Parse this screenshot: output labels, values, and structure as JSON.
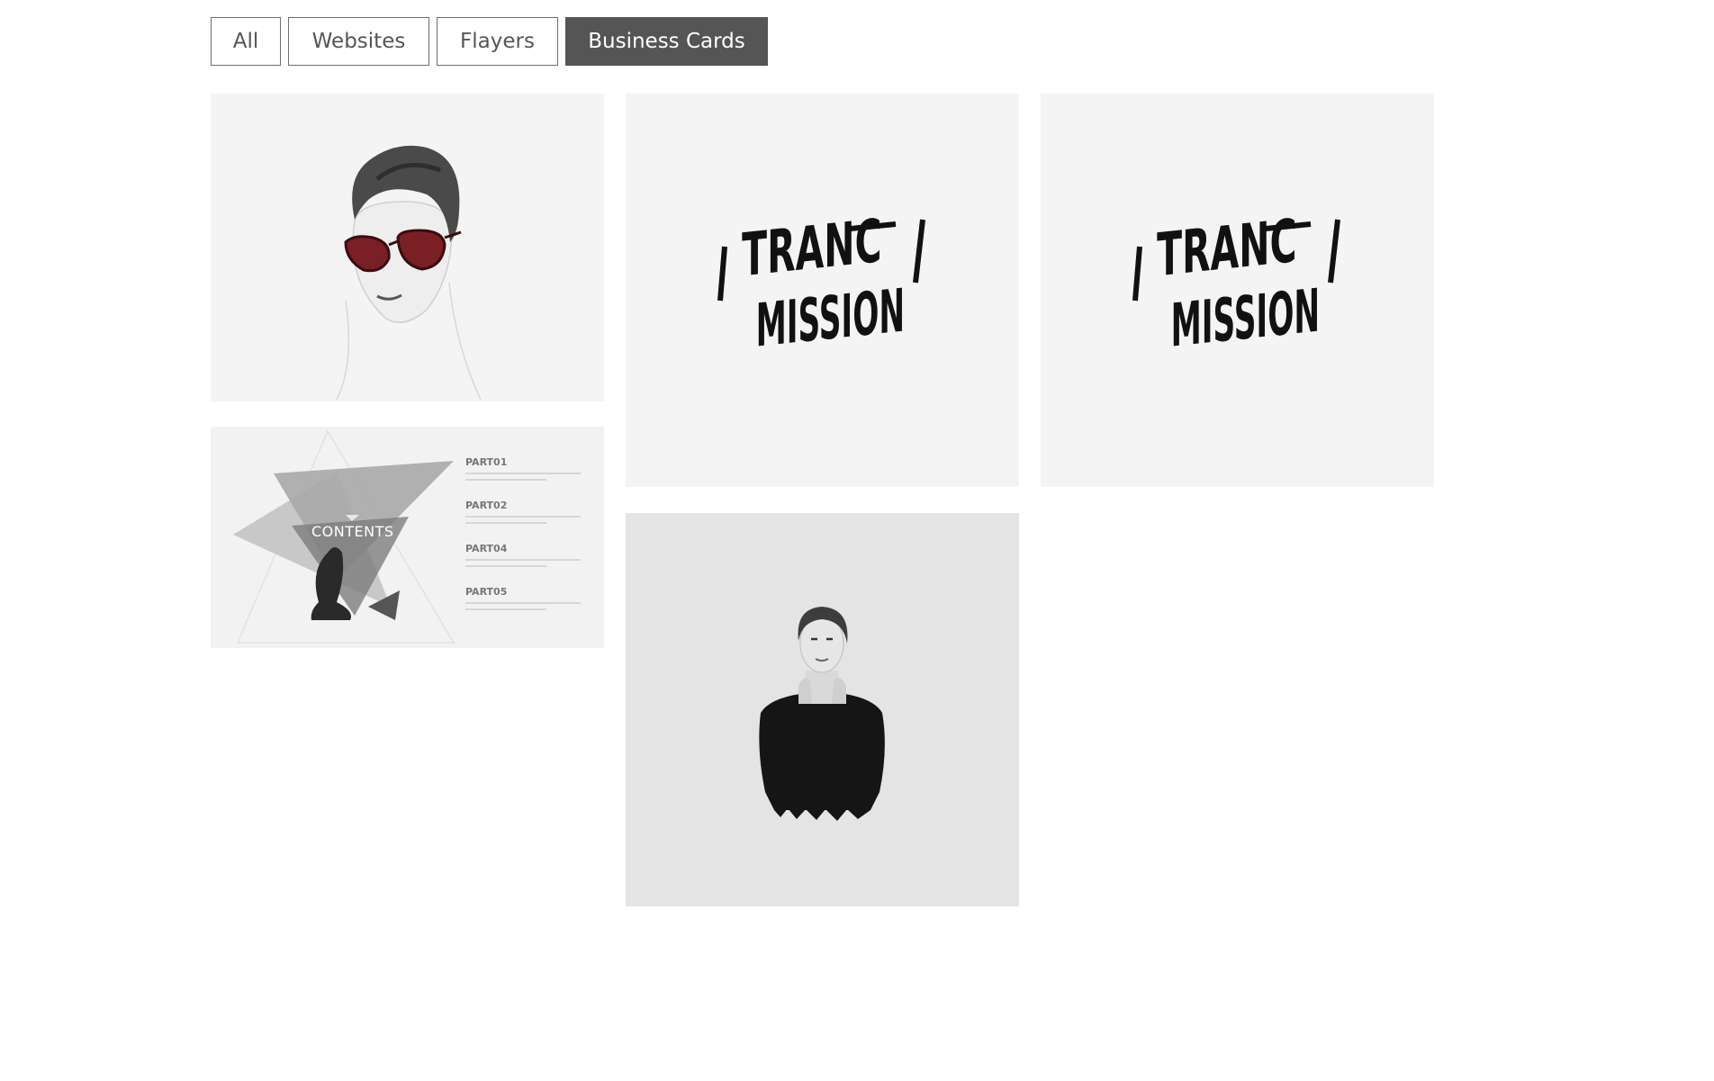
{
  "filters": {
    "items": [
      {
        "label": "All",
        "active": false
      },
      {
        "label": "Websites",
        "active": false
      },
      {
        "label": "Flayers",
        "active": false
      },
      {
        "label": "Business Cards",
        "active": true
      }
    ]
  },
  "gallery": {
    "tiles": [
      {
        "name": "sunglasses-woman-portrait",
        "description_icon": "portrait-image"
      },
      {
        "name": "contents-slide",
        "title": "CONTENTS",
        "parts": [
          "PART01",
          "PART02",
          "PART04",
          "PART05"
        ]
      },
      {
        "name": "transmission-logo",
        "logo_lines": [
          "TRANC",
          "MISSION"
        ]
      },
      {
        "name": "transmission-logo-duplicate",
        "logo_lines": [
          "TRANC",
          "MISSION"
        ]
      },
      {
        "name": "sweater-woman-portrait",
        "description_icon": "portrait-image"
      }
    ]
  },
  "colors": {
    "active_filter_bg": "#555555",
    "filter_border": "#6e6e6e",
    "tile_bg": "#f4f4f4",
    "sweater_tile_bg": "#e4e4e4",
    "glasses_red": "#7a1f24"
  }
}
